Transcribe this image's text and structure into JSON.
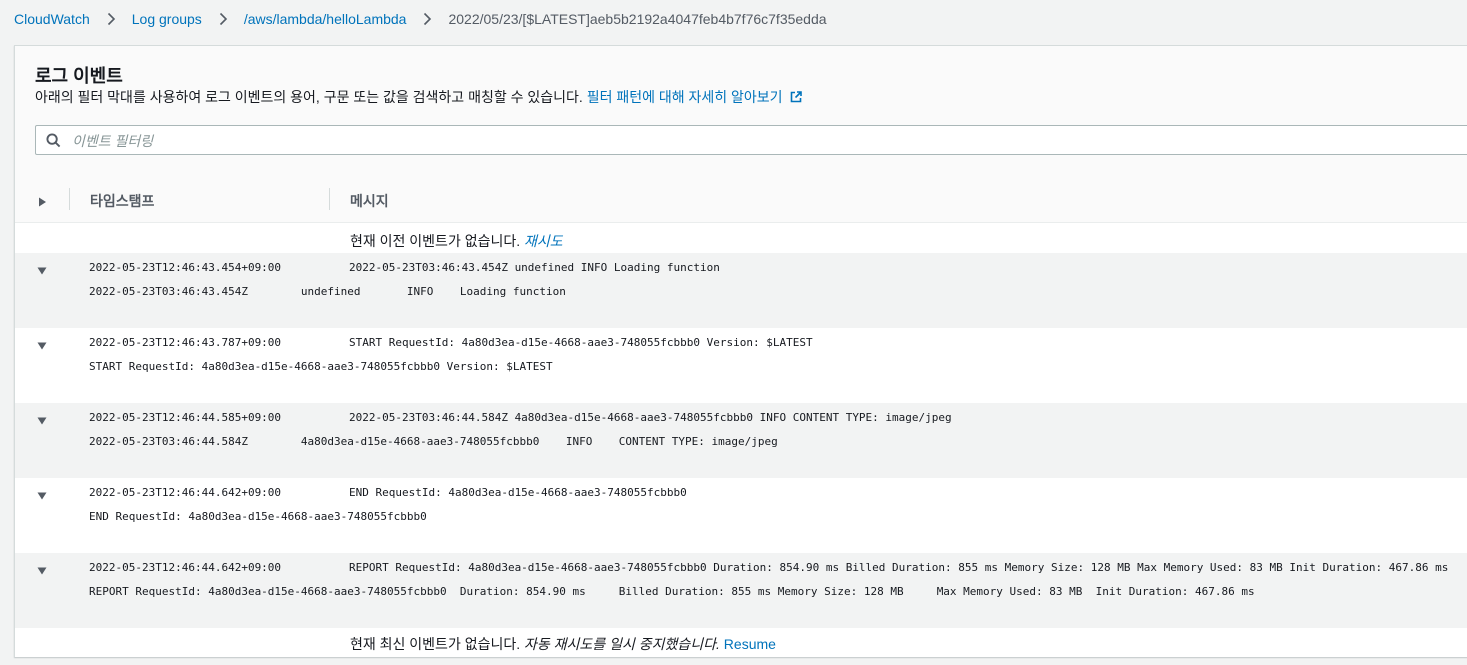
{
  "breadcrumb": {
    "items": [
      {
        "label": "CloudWatch"
      },
      {
        "label": "Log groups"
      },
      {
        "label": "/aws/lambda/helloLambda"
      }
    ],
    "current": "2022/05/23/[$LATEST]aeb5b2192a4047feb4b7f76c7f35edda"
  },
  "panel": {
    "title": "로그 이벤트",
    "description": "아래의 필터 막대를 사용하여 로그 이벤트의 용어, 구문 또는 값을 검색하고 매칭할 수 있습니다.",
    "learn_more_link": "필터 패턴에 대해 자세히 알아보기"
  },
  "filter": {
    "placeholder": "이벤트 필터링",
    "value": ""
  },
  "table": {
    "col_timestamp": "타임스탬프",
    "col_message": "메시지"
  },
  "top_notice": {
    "text": "현재 이전 이벤트가 없습니다.",
    "retry": "재시도"
  },
  "rows": [
    {
      "timestamp": "2022-05-23T12:46:43.454+09:00",
      "message": "2022-05-23T03:46:43.454Z undefined INFO Loading function",
      "detail": "2022-05-23T03:46:43.454Z        undefined       INFO    Loading function"
    },
    {
      "timestamp": "2022-05-23T12:46:43.787+09:00",
      "message": "START RequestId: 4a80d3ea-d15e-4668-aae3-748055fcbbb0 Version: $LATEST",
      "detail": "START RequestId: 4a80d3ea-d15e-4668-aae3-748055fcbbb0 Version: $LATEST"
    },
    {
      "timestamp": "2022-05-23T12:46:44.585+09:00",
      "message": "2022-05-23T03:46:44.584Z 4a80d3ea-d15e-4668-aae3-748055fcbbb0 INFO CONTENT TYPE: image/jpeg",
      "detail": "2022-05-23T03:46:44.584Z        4a80d3ea-d15e-4668-aae3-748055fcbbb0    INFO    CONTENT TYPE: image/jpeg"
    },
    {
      "timestamp": "2022-05-23T12:46:44.642+09:00",
      "message": "END RequestId: 4a80d3ea-d15e-4668-aae3-748055fcbbb0",
      "detail": "END RequestId: 4a80d3ea-d15e-4668-aae3-748055fcbbb0"
    },
    {
      "timestamp": "2022-05-23T12:46:44.642+09:00",
      "message": "REPORT RequestId: 4a80d3ea-d15e-4668-aae3-748055fcbbb0 Duration: 854.90 ms Billed Duration: 855 ms Memory Size: 128 MB Max Memory Used: 83 MB Init Duration: 467.86 ms",
      "detail": "REPORT RequestId: 4a80d3ea-d15e-4668-aae3-748055fcbbb0  Duration: 854.90 ms     Billed Duration: 855 ms Memory Size: 128 MB     Max Memory Used: 83 MB  Init Duration: 467.86 ms"
    }
  ],
  "bottom_notice": {
    "text": "현재 최신 이벤트가 없습니다.",
    "italic": "자동 재시도를 일시 중지했습니다.",
    "resume": "Resume"
  },
  "colors": {
    "link": "#0073bb",
    "shaded_row": "#f2f3f3",
    "text": "#16191f"
  }
}
